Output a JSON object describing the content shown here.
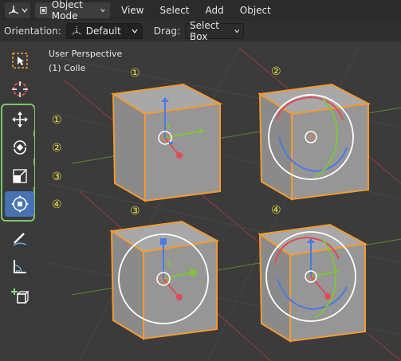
{
  "header": {
    "editor_icon": "axes-icon",
    "mode": "Object Mode",
    "menus": [
      "View",
      "Select",
      "Add",
      "Object"
    ]
  },
  "tool_header": {
    "orientation_label": "Orientation:",
    "orientation_value": "Default",
    "drag_label": "Drag:",
    "drag_value": "Select Box"
  },
  "viewport": {
    "perspective": "User Perspective",
    "collection": "(1) Colle"
  },
  "toolbar": {
    "tools": [
      "select-box",
      "cursor",
      "move",
      "rotate",
      "scale",
      "transform",
      "annotate",
      "measure",
      "add-cube"
    ],
    "active": "transform"
  },
  "legend": [
    "①",
    "②",
    "③",
    "④"
  ],
  "cube_labels": [
    "①",
    "②",
    "③",
    "④"
  ],
  "colors": {
    "highlight_green": "#7ec46a",
    "label_yellow": "#f0e040",
    "active_blue": "#4772b3",
    "outline_orange": "#f39a33"
  }
}
